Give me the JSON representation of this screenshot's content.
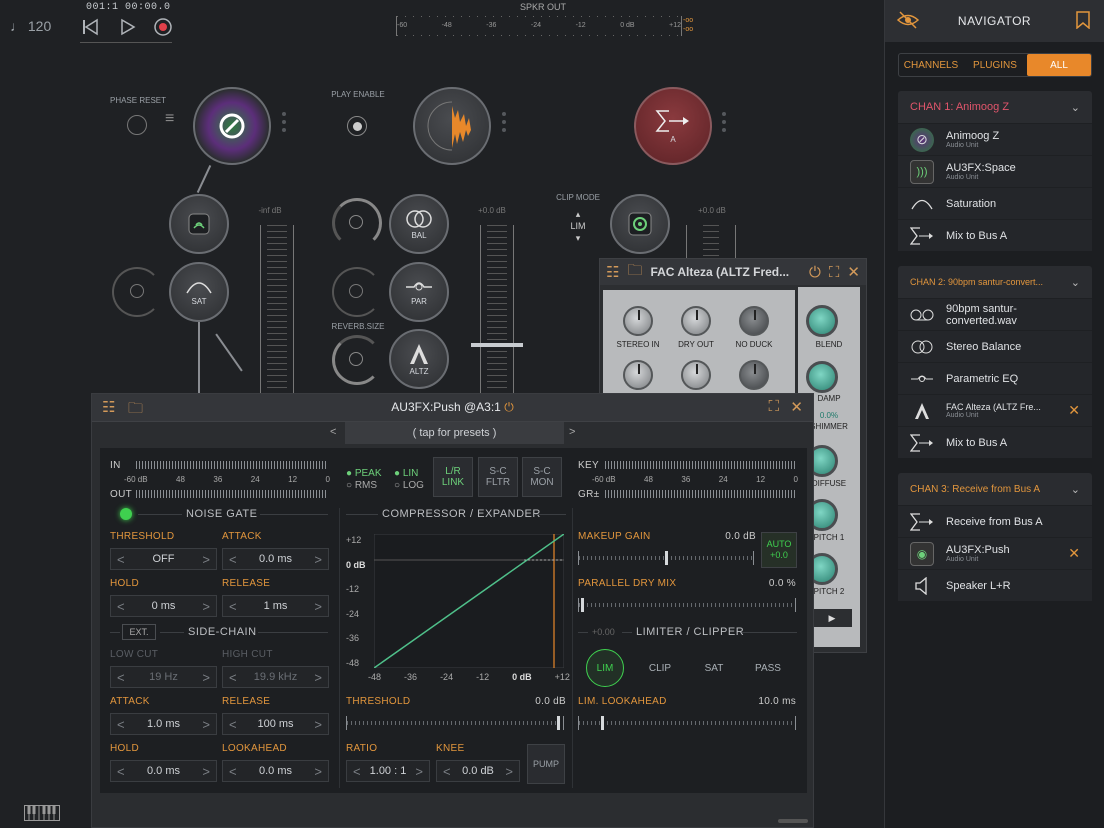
{
  "transport": {
    "tempo": "♩ 120",
    "position": "001:1   00:00.0"
  },
  "speaker_meter": {
    "title": "SPKR OUT",
    "ticks": [
      "-60",
      "-48",
      "-36",
      "-24",
      "-12",
      "0 dB",
      "+12"
    ]
  },
  "graph": {
    "phase_reset": "PHASE RESET",
    "play_enable": "PLAY ENABLE",
    "clip_mode": "CLIP MODE",
    "clip_mode_value": "LIM",
    "reverb_size": "REVERB.SIZE",
    "fader1_db": "-inf dB",
    "fader2_db": "+0.0 dB",
    "fader3_db": "+0.0 dB",
    "node_sat": "SAT",
    "node_bal": "BAL",
    "node_par": "PAR",
    "node_altz": "ALTZ",
    "node_a": "A"
  },
  "fac_window": {
    "title": "FAC Alteza (ALTZ Fred...",
    "knobs": [
      "STEREO IN",
      "DRY OUT",
      "NO DUCK"
    ],
    "side": [
      "BLEND",
      "DAMP",
      "SHIMMER",
      "DIFFUSE",
      "PITCH 1",
      "PITCH 2"
    ],
    "shimmer_val": "0.0%"
  },
  "push": {
    "title": "AU3FX:Push @A3:1",
    "presets": "( tap for presets )",
    "prev": "<",
    "next": ">",
    "in_label": "IN",
    "out_label": "OUT",
    "in_ticks": [
      "-60 dB",
      "48",
      "36",
      "24",
      "12",
      "0"
    ],
    "peak": "PEAK",
    "rms": "RMS",
    "lin": "LIN",
    "log": "LOG",
    "lr_link": [
      "L/R",
      "LINK"
    ],
    "sc_fltr": [
      "S-C",
      "FLTR"
    ],
    "sc_mon": [
      "S-C",
      "MON"
    ],
    "key_label": "KEY",
    "gr_label": "GR±",
    "key_ticks": [
      "-60 dB",
      "48",
      "36",
      "24",
      "12",
      "0"
    ],
    "noise_gate": "NOISE GATE",
    "threshold": {
      "label": "THRESHOLD",
      "value": "OFF"
    },
    "attack": {
      "label": "ATTACK",
      "value": "0.0 ms"
    },
    "hold": {
      "label": "HOLD",
      "value": "0 ms"
    },
    "release": {
      "label": "RELEASE",
      "value": "1 ms"
    },
    "ext": "EXT.",
    "side_chain": "SIDE-CHAIN",
    "low_cut": {
      "label": "LOW CUT",
      "value": "19 Hz"
    },
    "high_cut": {
      "label": "HIGH CUT",
      "value": "19.9 kHz"
    },
    "sc_attack": {
      "label": "ATTACK",
      "value": "1.0 ms"
    },
    "sc_release": {
      "label": "RELEASE",
      "value": "100 ms"
    },
    "sc_hold": {
      "label": "HOLD",
      "value": "0.0 ms"
    },
    "lookahead": {
      "label": "LOOKAHEAD",
      "value": "0.0 ms"
    },
    "comp_title": "COMPRESSOR / EXPANDER",
    "graph_y": [
      "+12",
      "0 dB",
      "-12",
      "-24",
      "-36",
      "-48"
    ],
    "graph_x": [
      "-48",
      "-36",
      "-24",
      "-12",
      "0 dB",
      "+12"
    ],
    "comp_threshold": {
      "label": "THRESHOLD",
      "value": "0.0 dB"
    },
    "ratio": {
      "label": "RATIO",
      "value": "1.00 : 1"
    },
    "knee": {
      "label": "KNEE",
      "value": "0.0 dB"
    },
    "pump": "PUMP",
    "makeup": {
      "label": "MAKEUP GAIN",
      "value": "0.0 dB"
    },
    "auto": [
      "AUTO",
      "+0.0"
    ],
    "parallel": {
      "label": "PARALLEL DRY MIX",
      "value": "0.0 %"
    },
    "limiter_gain": "+0.00",
    "limiter_title": "LIMITER / CLIPPER",
    "modes": [
      "LIM",
      "CLIP",
      "SAT",
      "PASS"
    ],
    "lookahead_lim": {
      "label": "LIM. LOOKAHEAD",
      "value": "10.0 ms"
    }
  },
  "navigator": {
    "title": "NAVIGATOR",
    "tabs": [
      "CHANNELS",
      "PLUGINS",
      "ALL"
    ],
    "chan1": {
      "title": "CHAN 1: Animoog Z",
      "items": [
        {
          "title": "Animoog Z",
          "sub": "Audio Unit"
        },
        {
          "title": "AU3FX:Space",
          "sub": "Audio Unit"
        },
        {
          "title": "Saturation",
          "sub": ""
        },
        {
          "title": "Mix to Bus A",
          "sub": ""
        }
      ]
    },
    "chan2": {
      "title": "CHAN 2: 90bpm santur-convert...",
      "items": [
        {
          "title": "90bpm santur-converted.wav",
          "sub": ""
        },
        {
          "title": "Stereo Balance",
          "sub": ""
        },
        {
          "title": "Parametric EQ",
          "sub": ""
        },
        {
          "title": "FAC Alteza (ALTZ Fre...",
          "sub": "Audio Unit"
        },
        {
          "title": "Mix to Bus A",
          "sub": ""
        }
      ]
    },
    "chan3": {
      "title": "CHAN 3: Receive from Bus A",
      "items": [
        {
          "title": "Receive from Bus A",
          "sub": ""
        },
        {
          "title": "AU3FX:Push",
          "sub": "Audio Unit"
        },
        {
          "title": "Speaker L+R",
          "sub": ""
        }
      ]
    }
  },
  "colors": {
    "accent": "#e8882a",
    "green": "#6dd07a",
    "chan1": "#e0556b",
    "chan": "#e2963d"
  }
}
